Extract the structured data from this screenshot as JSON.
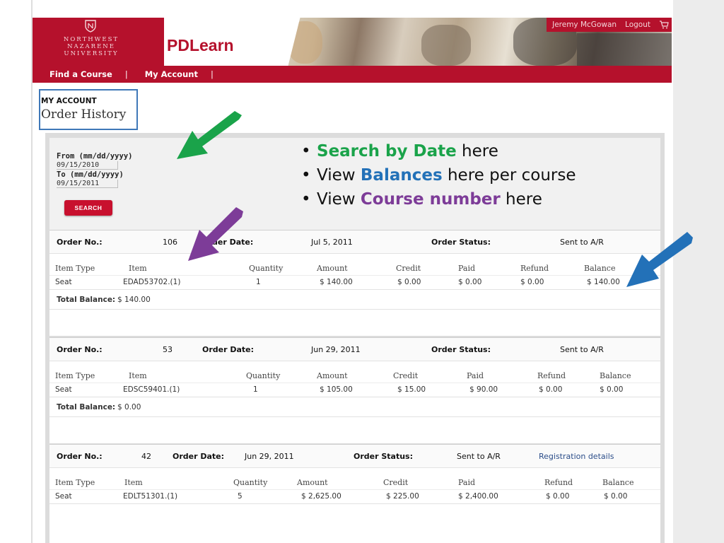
{
  "header": {
    "logo_text": "NORTHWEST\nNAZARENE\nUNIVERSITY",
    "app_name": "PDLearn",
    "user_name": "Jeremy McGowan",
    "logout_label": "Logout"
  },
  "nav": {
    "items": [
      {
        "label": "Find a Course"
      },
      {
        "label": "My Account"
      }
    ]
  },
  "page": {
    "section_label": "MY ACCOUNT",
    "title": "Order History"
  },
  "search": {
    "from_label": "From (mm/dd/yyyy)",
    "from_value": "09/15/2010",
    "to_label": "To (mm/dd/yyyy)",
    "to_value": "09/15/2011",
    "button_label": "SEARCH"
  },
  "callouts": [
    {
      "pre": "",
      "em": "Search by Date",
      "post": " here",
      "color": "#1aa34a"
    },
    {
      "pre": "View ",
      "em": "Balances",
      "post": " here per course",
      "color": "#2371b8"
    },
    {
      "pre": "View ",
      "em": "Course number",
      "post": " here",
      "color": "#7d3c98"
    }
  ],
  "labels": {
    "order_no": "Order No.:",
    "order_date": "Order Date:",
    "order_date_partial": "der Date:",
    "order_status": "Order Status:",
    "total_balance": "Total Balance:",
    "columns": [
      "Item Type",
      "Item",
      "Quantity",
      "Amount",
      "Credit",
      "Paid",
      "Refund",
      "Balance"
    ]
  },
  "orders": [
    {
      "order_no": "106",
      "date": "Jul 5, 2011",
      "status": "Sent to A/R",
      "rows": [
        {
          "type": "Seat",
          "item": "EDAD53702.(1)",
          "qty": "1",
          "amount": "$ 140.00",
          "credit": "$ 0.00",
          "paid": "$ 0.00",
          "refund": "$ 0.00",
          "balance": "$ 140.00"
        }
      ],
      "total_balance": "$ 140.00"
    },
    {
      "order_no": "53",
      "date": "Jun 29, 2011",
      "status": "Sent to A/R",
      "rows": [
        {
          "type": "Seat",
          "item": "EDSC59401.(1)",
          "qty": "1",
          "amount": "$ 105.00",
          "credit": "$ 15.00",
          "paid": "$ 90.00",
          "refund": "$ 0.00",
          "balance": "$ 0.00"
        }
      ],
      "total_balance": "$ 0.00"
    },
    {
      "order_no": "42",
      "date": "Jun 29, 2011",
      "status": "Sent to A/R",
      "link": "Registration details",
      "rows": [
        {
          "type": "Seat",
          "item": "EDLT51301.(1)",
          "qty": "5",
          "amount": "$ 2,625.00",
          "credit": "$ 225.00",
          "paid": "$ 2,400.00",
          "refund": "$ 0.00",
          "balance": "$ 0.00"
        }
      ]
    }
  ],
  "colors": {
    "brand_red": "#b5112c",
    "arrow_green": "#1aa34a",
    "arrow_purple": "#7d3c98",
    "arrow_blue": "#2371b8",
    "title_box": "#3f78b8"
  }
}
